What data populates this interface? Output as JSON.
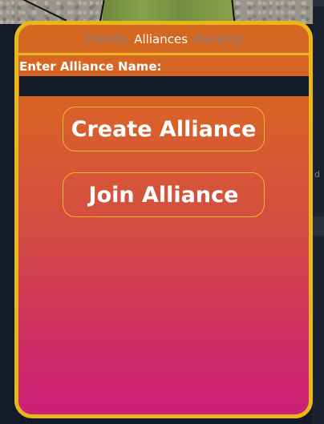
{
  "tabs": [
    {
      "label": "Friends",
      "active": false
    },
    {
      "label": "Alliances",
      "active": true
    },
    {
      "label": "Ranking",
      "active": false
    }
  ],
  "form": {
    "label": "Enter Alliance Name:",
    "input_value": "",
    "input_placeholder": ""
  },
  "buttons": {
    "create": "Create Alliance",
    "join": "Join Alliance"
  },
  "side": {
    "clipped_text": "d"
  },
  "colors": {
    "panel_border": "#e8b71c",
    "panel_top": "#d4691f",
    "panel_bottom": "#cc2078",
    "inactive_tab": "#8a7f8a",
    "active_tab": "#ffffff",
    "input_bg": "#121a28"
  }
}
